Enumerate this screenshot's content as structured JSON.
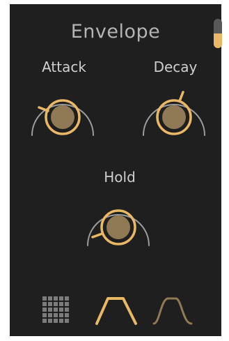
{
  "envelope": {
    "title": "Envelope",
    "toggle": {
      "level": 0.5,
      "on": true
    },
    "knobs": [
      {
        "id": "attack",
        "label": "Attack"
      },
      {
        "id": "decay",
        "label": "Decay"
      },
      {
        "id": "hold",
        "label": "Hold"
      }
    ],
    "footer": {
      "icons": [
        "grid-icon",
        "linear-envelope-icon",
        "curved-envelope-icon"
      ],
      "active": "linear-envelope-icon"
    }
  },
  "colors": {
    "panel": "#1f1f1f",
    "accent": "#e9b866",
    "knob_fill": "#8f7a55",
    "ring": "#9c9c9c",
    "label": "#cfcfcf",
    "title": "#b4b4b4",
    "grid_icon": "#7c7c7c",
    "curved_icon": "#8f7a55"
  }
}
